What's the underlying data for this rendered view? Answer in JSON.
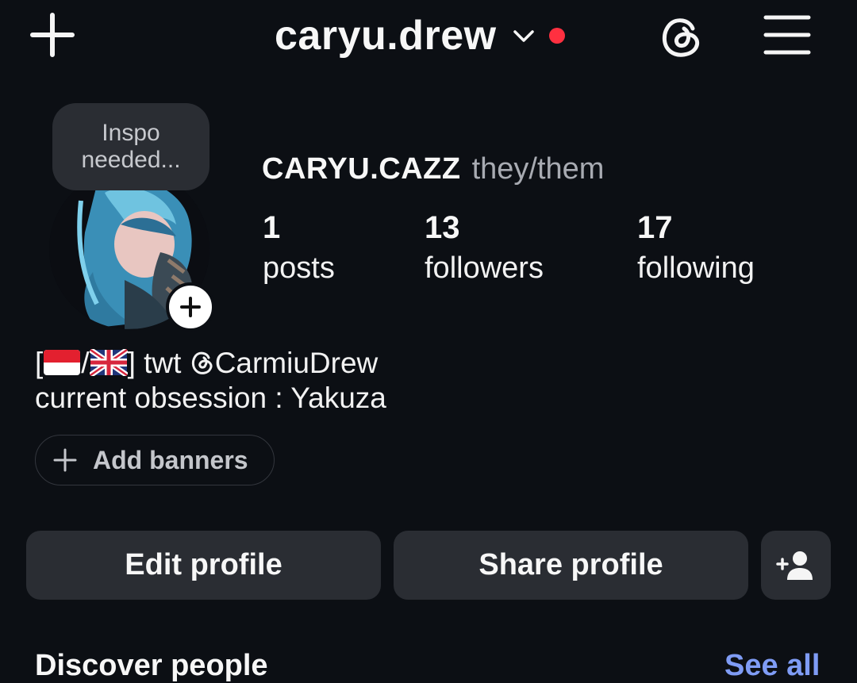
{
  "header": {
    "username": "caryu.drew",
    "icons": {
      "create": "plus-icon",
      "account_switcher": "chevron-down-icon",
      "notification": "red-dot",
      "threads": "threads-icon",
      "menu": "hamburger-menu-icon"
    },
    "notification_color": "#ff3040"
  },
  "profile": {
    "note": [
      "Inspo",
      "needed..."
    ],
    "avatar_add_icon": "plus-icon",
    "display_name": "CARYU.CAZZ",
    "pronouns": "they/them",
    "stats": [
      {
        "value": "1",
        "label": "posts"
      },
      {
        "value": "13",
        "label": "followers"
      },
      {
        "value": "17",
        "label": "following"
      }
    ],
    "bio": {
      "line1_open": "[",
      "line1_flag1": "indonesia-flag",
      "line1_slash": "/",
      "line1_flag2": "uk-flag",
      "line1_rest": "] twt ",
      "line1_handle": "CarmiuDrew",
      "line1_handle_icon": "threads-icon",
      "line2": "current obsession : Yakuza"
    },
    "add_banners_label": "Add banners"
  },
  "actions": {
    "edit_profile": "Edit profile",
    "share_profile": "Share profile",
    "add_person_icon": "add-person-icon"
  },
  "discover": {
    "title": "Discover people",
    "see_all": "See all",
    "link_color": "#7f9cf5"
  }
}
